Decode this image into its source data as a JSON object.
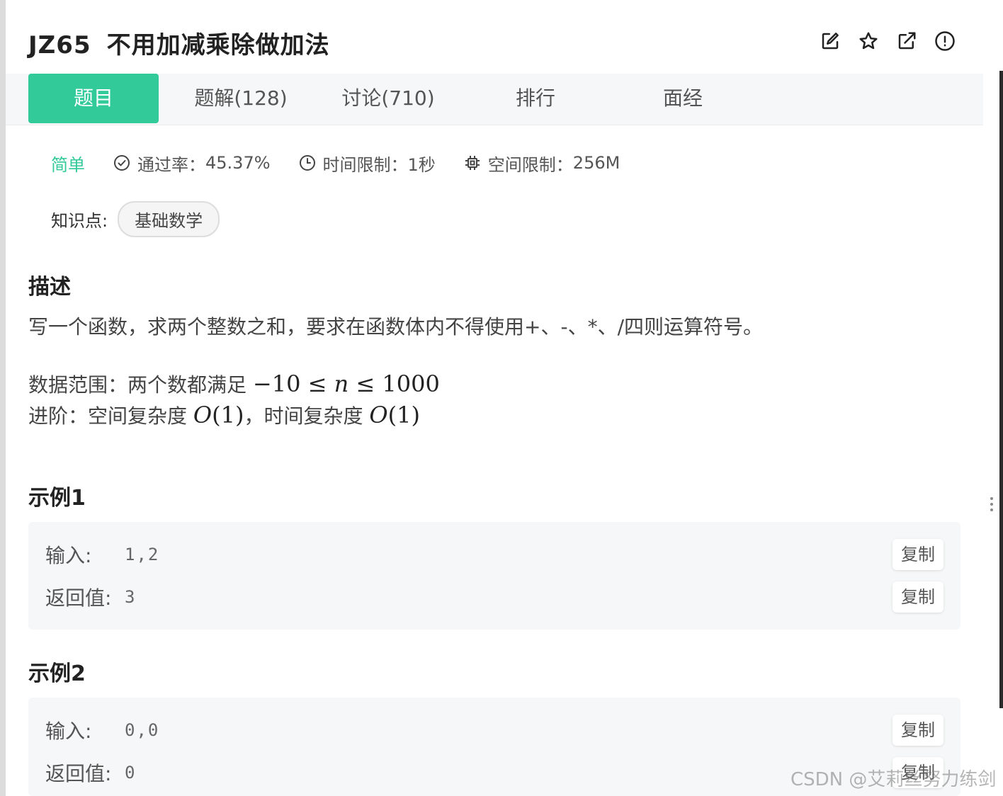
{
  "problem": {
    "code": "JZ65",
    "name": "不用加减乘除做加法"
  },
  "toolbar": {
    "icons": [
      "edit-icon",
      "star-icon",
      "external-link-icon",
      "alert-icon"
    ]
  },
  "tabs": [
    {
      "label": "题目",
      "active": true
    },
    {
      "label": "题解(128)",
      "active": false
    },
    {
      "label": "讨论(710)",
      "active": false
    },
    {
      "label": "排行",
      "active": false
    },
    {
      "label": "面经",
      "active": false
    }
  ],
  "meta": {
    "difficulty": "简单",
    "pass_rate_label": "通过率：",
    "pass_rate": "45.37%",
    "time_limit_label": "时间限制：",
    "time_limit": "1秒",
    "space_limit_label": "空间限制：",
    "space_limit": "256M"
  },
  "knowledge": {
    "label": "知识点:",
    "tag": "基础数学"
  },
  "description": {
    "title": "描述",
    "text": "写一个函数，求两个整数之和，要求在函数体内不得使用+、-、*、/四则运算符号。",
    "range_label": "数据范围：两个数都满足",
    "advanced_label": "进阶：空间复杂度",
    "advanced_sep": "，时间复杂度"
  },
  "examples": [
    {
      "title": "示例1",
      "input_label": "输入:",
      "input": "1,2",
      "output_label": "返回值:",
      "output": "3",
      "copy_label": "复制"
    },
    {
      "title": "示例2",
      "input_label": "输入:",
      "input": "0,0",
      "output_label": "返回值:",
      "output": "0",
      "copy_label": "复制"
    }
  ],
  "watermark": "CSDN @艾莉丝努力练剑",
  "colors": {
    "accent": "#32ca99",
    "panel_bg": "#ffffff",
    "box_bg": "#f6f7f8"
  }
}
